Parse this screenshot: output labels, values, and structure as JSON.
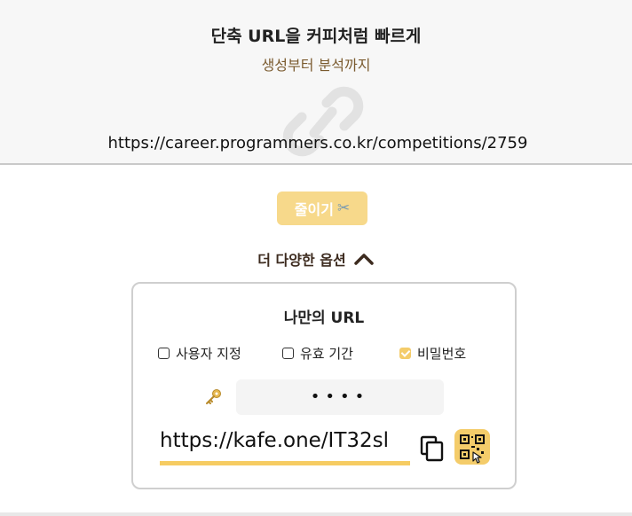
{
  "hero": {
    "title": "단축 URL을 커피처럼 빠르게",
    "subtitle": "생성부터 분석까지"
  },
  "url_input": {
    "value": "https://career.programmers.co.kr/competitions/2759"
  },
  "shorten_button": {
    "label": "줄이기",
    "icon": "scissors-icon"
  },
  "more_options": {
    "label": "더 다양한 옵션",
    "icon": "chevron-up-icon"
  },
  "options_card": {
    "title": "나만의 URL",
    "checkboxes": [
      {
        "label": "사용자 지정",
        "checked": false
      },
      {
        "label": "유효 기간",
        "checked": false
      },
      {
        "label": "비밀번호",
        "checked": true
      }
    ],
    "password": {
      "icon": "key-icon",
      "masked_value": "••••"
    },
    "result": {
      "short_url": "https://kafe.one/IT32sl",
      "copy_icon": "copy-icon",
      "qr_icon": "qr-code-icon"
    }
  },
  "colors": {
    "accent": "#f4cc6a",
    "button": "#f7d98b",
    "subtitle": "#7a5a2e",
    "options_text": "#3d2b1f"
  }
}
